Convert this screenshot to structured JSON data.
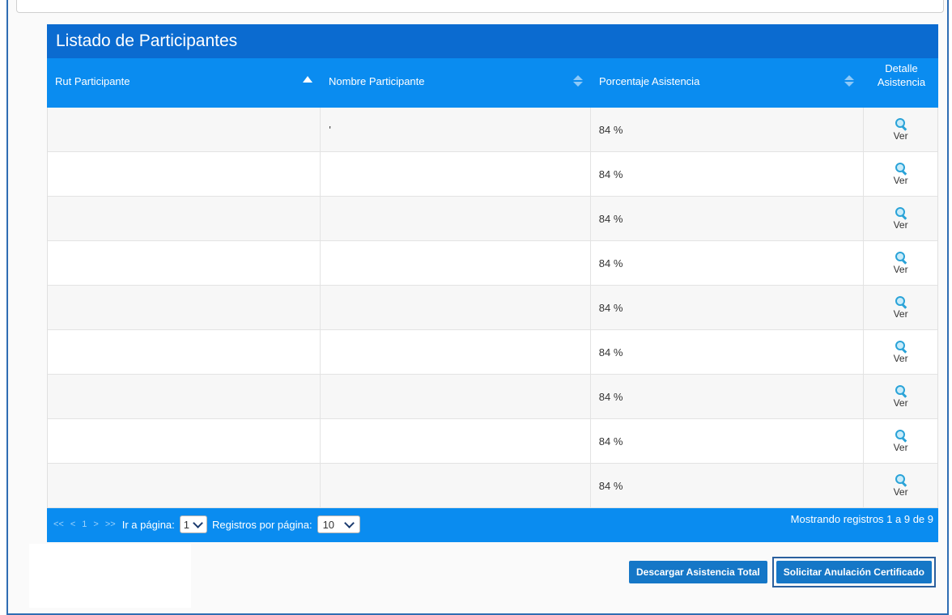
{
  "panel": {
    "title": "Listado de Participantes"
  },
  "table": {
    "columns": {
      "rut": "Rut Participante",
      "nombre": "Nombre Participante",
      "porcentaje": "Porcentaje Asistencia",
      "detalle_line1": "Detalle",
      "detalle_line2": "Asistencia"
    },
    "rows": [
      {
        "rut": "",
        "nombre": "'",
        "porcentaje": "84 %",
        "detalle": "Ver"
      },
      {
        "rut": "",
        "nombre": "",
        "porcentaje": "84 %",
        "detalle": "Ver"
      },
      {
        "rut": "",
        "nombre": "",
        "porcentaje": "84 %",
        "detalle": "Ver"
      },
      {
        "rut": "",
        "nombre": "",
        "porcentaje": "84 %",
        "detalle": "Ver"
      },
      {
        "rut": "",
        "nombre": "",
        "porcentaje": "84 %",
        "detalle": "Ver"
      },
      {
        "rut": "",
        "nombre": "",
        "porcentaje": "84 %",
        "detalle": "Ver"
      },
      {
        "rut": "",
        "nombre": "",
        "porcentaje": "84 %",
        "detalle": "Ver"
      },
      {
        "rut": "",
        "nombre": "",
        "porcentaje": "84 %",
        "detalle": "Ver"
      },
      {
        "rut": "",
        "nombre": "",
        "porcentaje": "84 %",
        "detalle": "Ver"
      }
    ],
    "detail_icon": "magnifier-icon"
  },
  "pager": {
    "first": "<<",
    "prev": "<",
    "page": "1",
    "next": ">",
    "last": ">>",
    "goto_label": "Ir a página:",
    "goto_value": "1",
    "per_page_label": "Registros por página:",
    "per_page_value": "10",
    "showing": "Mostrando registros 1 a 9 de 9"
  },
  "actions": {
    "download": "Descargar Asistencia Total",
    "cancel_cert": "Solicitar Anulación Certificado"
  },
  "colors": {
    "title_bar": "#0b6bd0",
    "header_bar": "#0a8cf0",
    "button": "#1577c7",
    "frame": "#2f6db3"
  }
}
